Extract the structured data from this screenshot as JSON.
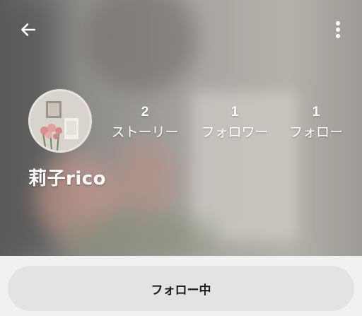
{
  "header": {
    "back_icon": "arrow-left-icon",
    "more_icon": "more-vertical-icon"
  },
  "profile": {
    "name": "莉子rico",
    "avatar_alt": "profile photo of flowers and frames",
    "stats": [
      {
        "count": "2",
        "label": "ストーリー"
      },
      {
        "count": "1",
        "label": "フォロワー"
      },
      {
        "count": "1",
        "label": "フォロー"
      }
    ]
  },
  "actions": {
    "follow_label": "フォロー中"
  }
}
